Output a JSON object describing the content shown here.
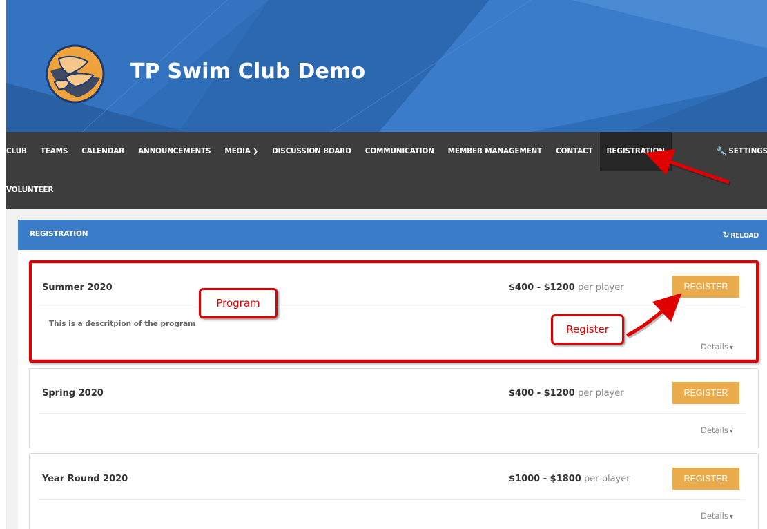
{
  "site": {
    "title": "TP Swim Club Demo"
  },
  "nav": {
    "items": [
      {
        "label": "CLUB"
      },
      {
        "label": "TEAMS"
      },
      {
        "label": "CALENDAR"
      },
      {
        "label": "ANNOUNCEMENTS"
      },
      {
        "label": "MEDIA"
      },
      {
        "label": "DISCUSSION BOARD"
      },
      {
        "label": "COMMUNICATION"
      },
      {
        "label": "MEMBER MANAGEMENT"
      },
      {
        "label": "CONTACT"
      },
      {
        "label": "REGISTRATION"
      }
    ],
    "active": "REGISTRATION",
    "settings": "SETTINGS",
    "row2": "VOLUNTEER"
  },
  "panel": {
    "title": "REGISTRATION",
    "reload": "RELOAD"
  },
  "programs": [
    {
      "name": "Summer 2020",
      "price_range": "$400 - $1200",
      "price_unit": "per player",
      "description": "This is a descritpion of the program",
      "register": "REGISTER",
      "details": "Details"
    },
    {
      "name": "Spring 2020",
      "price_range": "$400 - $1200",
      "price_unit": "per player",
      "description": "",
      "register": "REGISTER",
      "details": "Details"
    },
    {
      "name": "Year Round 2020",
      "price_range": "$1000 - $1800",
      "price_unit": "per player",
      "description": "",
      "register": "REGISTER",
      "details": "Details"
    }
  ],
  "annotations": {
    "program": "Program",
    "register": "Register"
  },
  "colors": {
    "banner": "#2e6db8",
    "nav": "#3d3d3d",
    "panel_header": "#3a7cc8",
    "register_button": "#e9ab4c",
    "annotation": "#e00000"
  },
  "icons": {
    "logo": "hands-logo",
    "media_chevron": "chevron-down-icon",
    "settings": "wrench-icon",
    "reload": "refresh-icon",
    "details_chevron": "chevron-down-icon"
  }
}
